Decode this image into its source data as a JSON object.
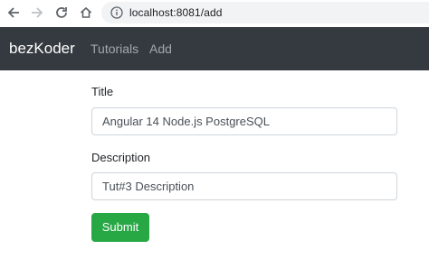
{
  "browser": {
    "url": "localhost:8081/add",
    "icons": [
      "back-icon",
      "forward-icon",
      "reload-icon",
      "home-icon",
      "info-icon"
    ]
  },
  "navbar": {
    "brand": "bezKoder",
    "links": [
      "Tutorials",
      "Add"
    ]
  },
  "form": {
    "title_label": "Title",
    "title_value": "Angular 14 Node.js PostgreSQL",
    "description_label": "Description",
    "description_value": "Tut#3 Description",
    "submit_label": "Submit"
  },
  "colors": {
    "navbar_bg": "#343a40",
    "submit_bg": "#28a745",
    "address_bar_bg": "#f1f3f4"
  }
}
